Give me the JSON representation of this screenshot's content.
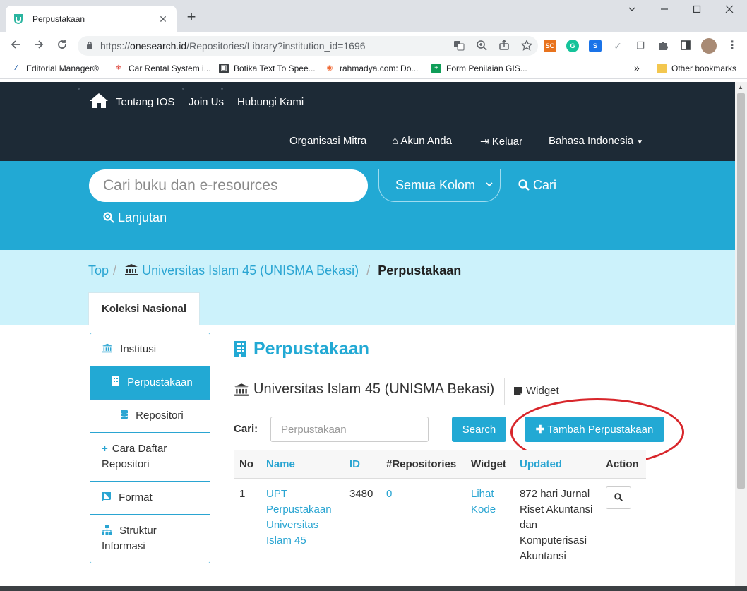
{
  "browser": {
    "tab_title": "Perpustakaan",
    "tab_close": "✕",
    "new_tab": "+",
    "minimize": "⌄",
    "maximize": "☐",
    "close": "✕",
    "url_host": "onesearch.id",
    "url_prefix": "https://",
    "url_path": "/Repositories/Library?institution_id=1696",
    "bookmarks": [
      "Editorial Manager®",
      "Car Rental System i...",
      "Botika Text To Spee...",
      "rahmadya.com: Do...",
      "Form Penilaian GIS...",
      "Other bookmarks"
    ],
    "bookmarks_more": "»"
  },
  "nav": {
    "home_icon": "house-icon",
    "tentang": "Tentang IOS",
    "join": "Join Us",
    "hubungi": "Hubungi Kami",
    "mitra": "Organisasi Mitra",
    "akun": "Akun Anda",
    "keluar": "Keluar",
    "bahasa": "Bahasa Indonesia"
  },
  "search": {
    "placeholder": "Cari buku dan e-resources",
    "kolom": "Semua Kolom",
    "cari": "Cari",
    "lanjutan": "Lanjutan"
  },
  "breadcrumb": {
    "top": "Top",
    "institution": "Universitas Islam 45 (UNISMA Bekasi)",
    "current": "Perpustakaan",
    "separator": "/"
  },
  "tabs": {
    "koleksi": "Koleksi Nasional"
  },
  "sidebar": {
    "items": [
      {
        "label": "Institusi"
      },
      {
        "label": "Perpustakaan"
      },
      {
        "label": "Repositori"
      },
      {
        "label": "Cara Daftar Repositori"
      },
      {
        "label": "Format"
      },
      {
        "label": "Struktur Informasi"
      }
    ]
  },
  "main": {
    "title": "Perpustakaan",
    "institution": "Universitas Islam 45 (UNISMA Bekasi)",
    "widget": "Widget",
    "cari_label": "Cari:",
    "filter_placeholder": "Perpustakaan",
    "search_button": "Search",
    "add_button": "Tambah Perpustakaan"
  },
  "table": {
    "headers": [
      "No",
      "Name",
      "ID",
      "#Repositories",
      "Widget",
      "Updated",
      "Action"
    ],
    "rows": [
      {
        "no": "1",
        "name": "UPT Perpustakaan Universitas Islam 45",
        "id": "3480",
        "repositories": "0",
        "widget": "Lihat Kode",
        "updated": "872 hari Jurnal Riset Akuntansi dan Komputerisasi Akuntansi"
      }
    ]
  },
  "colors": {
    "nav_bg": "#1d2a36",
    "accent": "#22a9d4",
    "breadcrumb_bg": "#ccf2fb",
    "annotation": "#d8262b"
  }
}
